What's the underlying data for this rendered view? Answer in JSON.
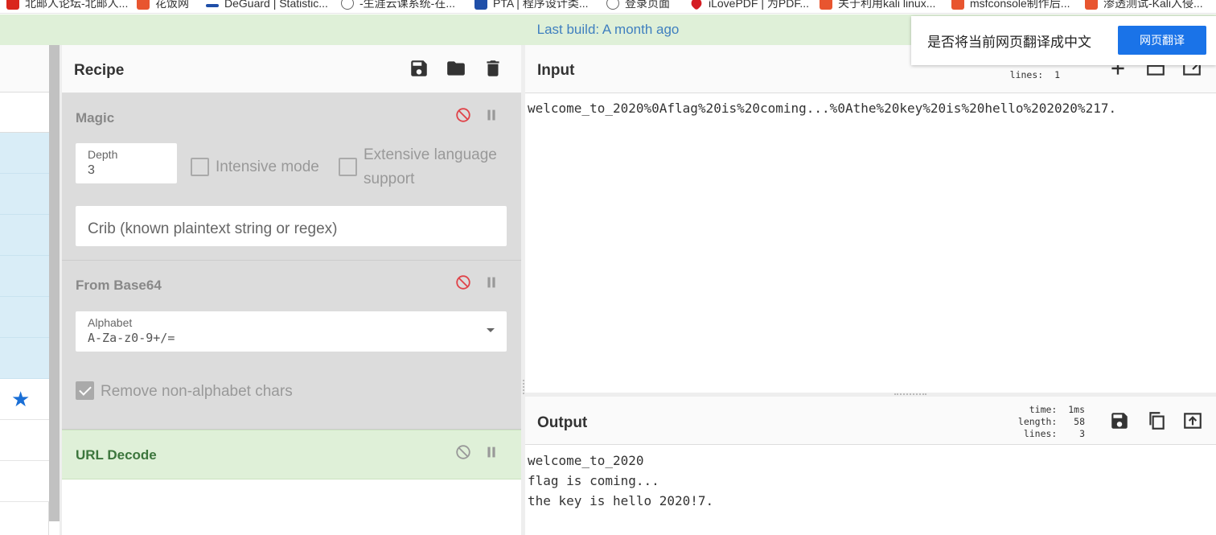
{
  "bookmarks": [
    {
      "label": "北邮人论坛-北邮人...",
      "icon": "bbs-icon"
    },
    {
      "label": "花饭网",
      "icon": "site-icon"
    },
    {
      "label": "DeGuard | Statistic...",
      "icon": "deguard-icon"
    },
    {
      "label": "-生涯云课系统-在...",
      "icon": "globe-icon"
    },
    {
      "label": "PTA | 程序设计类...",
      "icon": "pta-icon"
    },
    {
      "label": "登录页面",
      "icon": "globe-icon"
    },
    {
      "label": "iLovePDF | 为PDF...",
      "icon": "heart-icon"
    },
    {
      "label": "关于利用kali linux...",
      "icon": "csdn-icon"
    },
    {
      "label": "msfconsole制作后...",
      "icon": "csdn-icon"
    },
    {
      "label": "渗透测试-Kali入侵...",
      "icon": "csdn-icon"
    }
  ],
  "banner": {
    "text": "Last build: A month ago"
  },
  "translate": {
    "question": "是否将当前网页翻译成中文",
    "button": "网页翻译"
  },
  "recipe": {
    "title": "Recipe",
    "operations": [
      {
        "name": "Magic",
        "depth_label": "Depth",
        "depth_value": "3",
        "intensive_label": "Intensive mode",
        "extensive_label_1": "Extensive language",
        "extensive_label_2": "support",
        "crib_placeholder": "Crib (known plaintext string or regex)"
      },
      {
        "name": "From Base64",
        "alphabet_label": "Alphabet",
        "alphabet_value": "A-Za-z0-9+/=",
        "remove_label": "Remove non-alphabet chars",
        "remove_checked": true
      },
      {
        "name": "URL Decode"
      }
    ]
  },
  "input": {
    "title": "Input",
    "stats_lines_label": "lines:",
    "stats_lines_value": "1",
    "text": "welcome_to_2020%0Aflag%20is%20coming...%0Athe%20key%20is%20hello%202020%217."
  },
  "output": {
    "title": "Output",
    "time_label": "time:",
    "time_value": "1ms",
    "length_label": "length:",
    "length_value": "58",
    "lines_label": "lines:",
    "lines_value": "3",
    "text": "welcome_to_2020\nflag is coming...\nthe key is hello 2020!7."
  },
  "colors": {
    "banner_bg": "#dff0d8",
    "banner_text": "#3f7fbf",
    "op_bg": "#dcdcdc",
    "url_decode_bg": "#dff0d8",
    "url_decode_text": "#3c763d",
    "disable_icon": "#e0444a",
    "translate_button": "#1a73e8",
    "favourite_star": "#1a6fd6"
  }
}
